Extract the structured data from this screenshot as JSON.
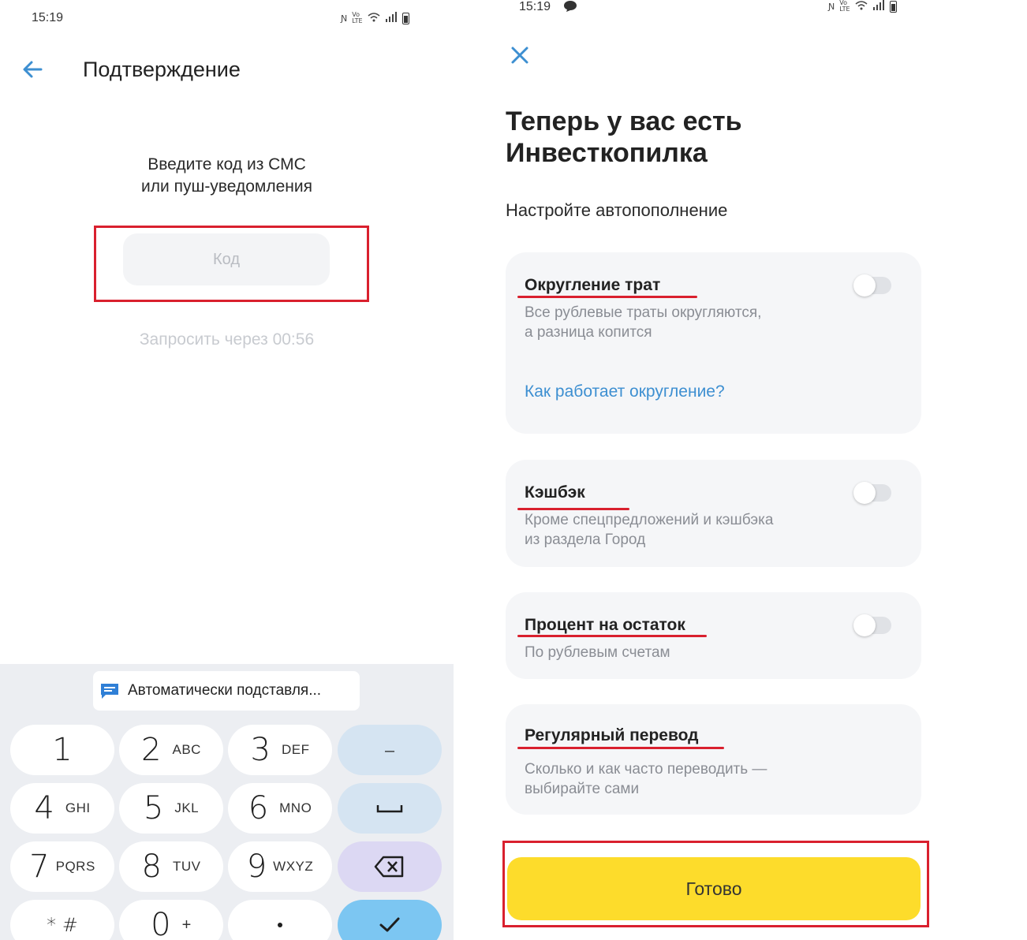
{
  "left": {
    "status_time": "15:19",
    "title": "Подтверждение",
    "prompt_line1": "Введите код из СМС",
    "prompt_line2": "или пуш-уведомления",
    "code_placeholder": "Код",
    "resend_text": "Запросить через 00:56",
    "keyboard": {
      "suggestion": "Автоматически подставля...",
      "keys": [
        {
          "digit": "1",
          "letters": ""
        },
        {
          "digit": "2",
          "letters": "ABC"
        },
        {
          "digit": "3",
          "letters": "DEF"
        },
        {
          "digit": "4",
          "letters": "GHI"
        },
        {
          "digit": "5",
          "letters": "JKL"
        },
        {
          "digit": "6",
          "letters": "MNO"
        },
        {
          "digit": "7",
          "letters": "PQRS"
        },
        {
          "digit": "8",
          "letters": "TUV"
        },
        {
          "digit": "9",
          "letters": "WXYZ"
        },
        {
          "digit": "* #",
          "letters": ""
        },
        {
          "digit": "0",
          "letters": "+"
        }
      ],
      "minus_label": "–"
    }
  },
  "right": {
    "status_time": "15:19",
    "title_line1": "Теперь у вас есть",
    "title_line2": "Инвесткопилка",
    "subtitle": "Настройте автопополнение",
    "cards": [
      {
        "title": "Округление трат",
        "desc1": "Все рублевые траты округляются,",
        "desc2": "а разница копится",
        "link": "Как работает округление?",
        "enabled": false
      },
      {
        "title": "Кэшбэк",
        "desc1": "Кроме спецпредложений и кэшбэка",
        "desc2": "из раздела Город",
        "enabled": false
      },
      {
        "title": "Процент на остаток",
        "desc1": "По рублевым счетам",
        "enabled": false
      },
      {
        "title": "Регулярный перевод",
        "desc1": "Сколько и как часто переводить —",
        "desc2": "выбирайте сами"
      }
    ],
    "done_label": "Готово"
  },
  "colors": {
    "accent_yellow": "#fddc2b",
    "link_blue": "#3d8fd1",
    "annotation_red": "#d9202e"
  }
}
